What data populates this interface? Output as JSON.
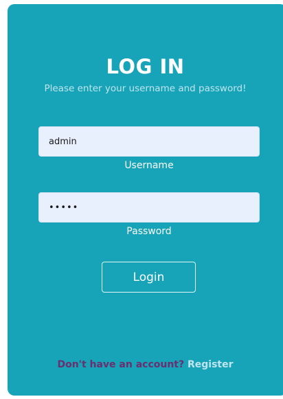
{
  "login_form": {
    "title": "LOG IN",
    "subtitle": "Please enter your username and password!",
    "username": {
      "value": "admin",
      "label": "Username"
    },
    "password": {
      "value": "•••••",
      "label": "Password"
    },
    "submit_label": "Login",
    "footer": {
      "prompt": "Don't have an account?",
      "link_label": "Register"
    }
  },
  "colors": {
    "card_background": "#17a3b8",
    "input_background": "#e8f0fe",
    "prompt_text": "#6b2e6f",
    "link_text": "#bfe6ee"
  }
}
